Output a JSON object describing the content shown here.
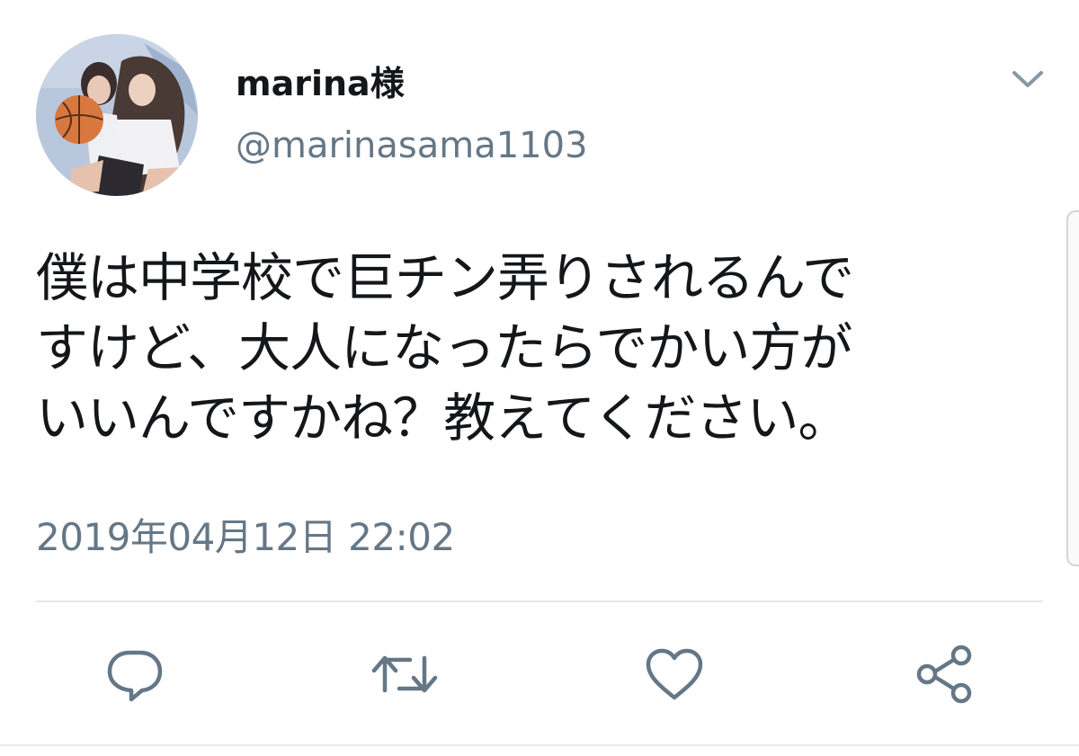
{
  "user": {
    "display_name": "marina様",
    "handle": "@marinasama1103"
  },
  "tweet": {
    "lines": [
      "僕は中学校で巨チン弄りされるんで",
      "すけど、大人になったらでかい方が",
      "いいんですかね？教えてください。"
    ],
    "timestamp": "2019年04月12日 22:02"
  },
  "icons": {
    "menu": "chevron-down-icon",
    "reply": "reply-icon",
    "retweet": "retweet-icon",
    "like": "heart-icon",
    "share": "share-icon"
  },
  "colors": {
    "text_primary": "#14171a",
    "text_secondary": "#657786",
    "icon": "#657786",
    "divider": "#e1e8ed"
  }
}
